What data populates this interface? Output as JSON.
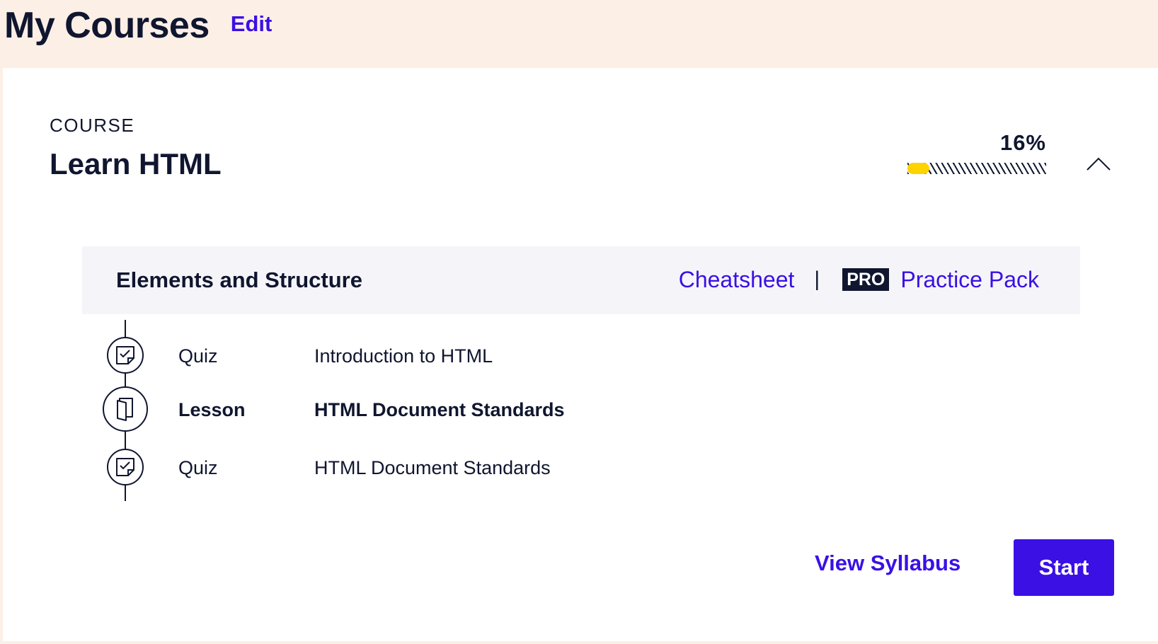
{
  "header": {
    "title": "My Courses",
    "edit_label": "Edit"
  },
  "course": {
    "kicker": "COURSE",
    "title": "Learn HTML",
    "progress_label": "16%",
    "progress_value": 0.16,
    "collapse_icon": "chevron-up-icon"
  },
  "module": {
    "title": "Elements and Structure",
    "cheatsheet_label": "Cheatsheet",
    "divider": "|",
    "pro_badge": "PRO",
    "practice_label": "Practice Pack"
  },
  "items": [
    {
      "type": "Quiz",
      "name": "Introduction to HTML",
      "icon": "quiz-icon",
      "current": false
    },
    {
      "type": "Lesson",
      "name": "HTML Document Standards",
      "icon": "lesson-icon",
      "current": true
    },
    {
      "type": "Quiz",
      "name": "HTML Document Standards",
      "icon": "quiz-icon",
      "current": false
    }
  ],
  "actions": {
    "syllabus_label": "View Syllabus",
    "start_label": "Start"
  },
  "colors": {
    "accent": "#3a10e5",
    "ink": "#10162f",
    "progress": "#ffd300",
    "page_bg": "#fcefe6",
    "module_bg": "#f5f5f9"
  }
}
